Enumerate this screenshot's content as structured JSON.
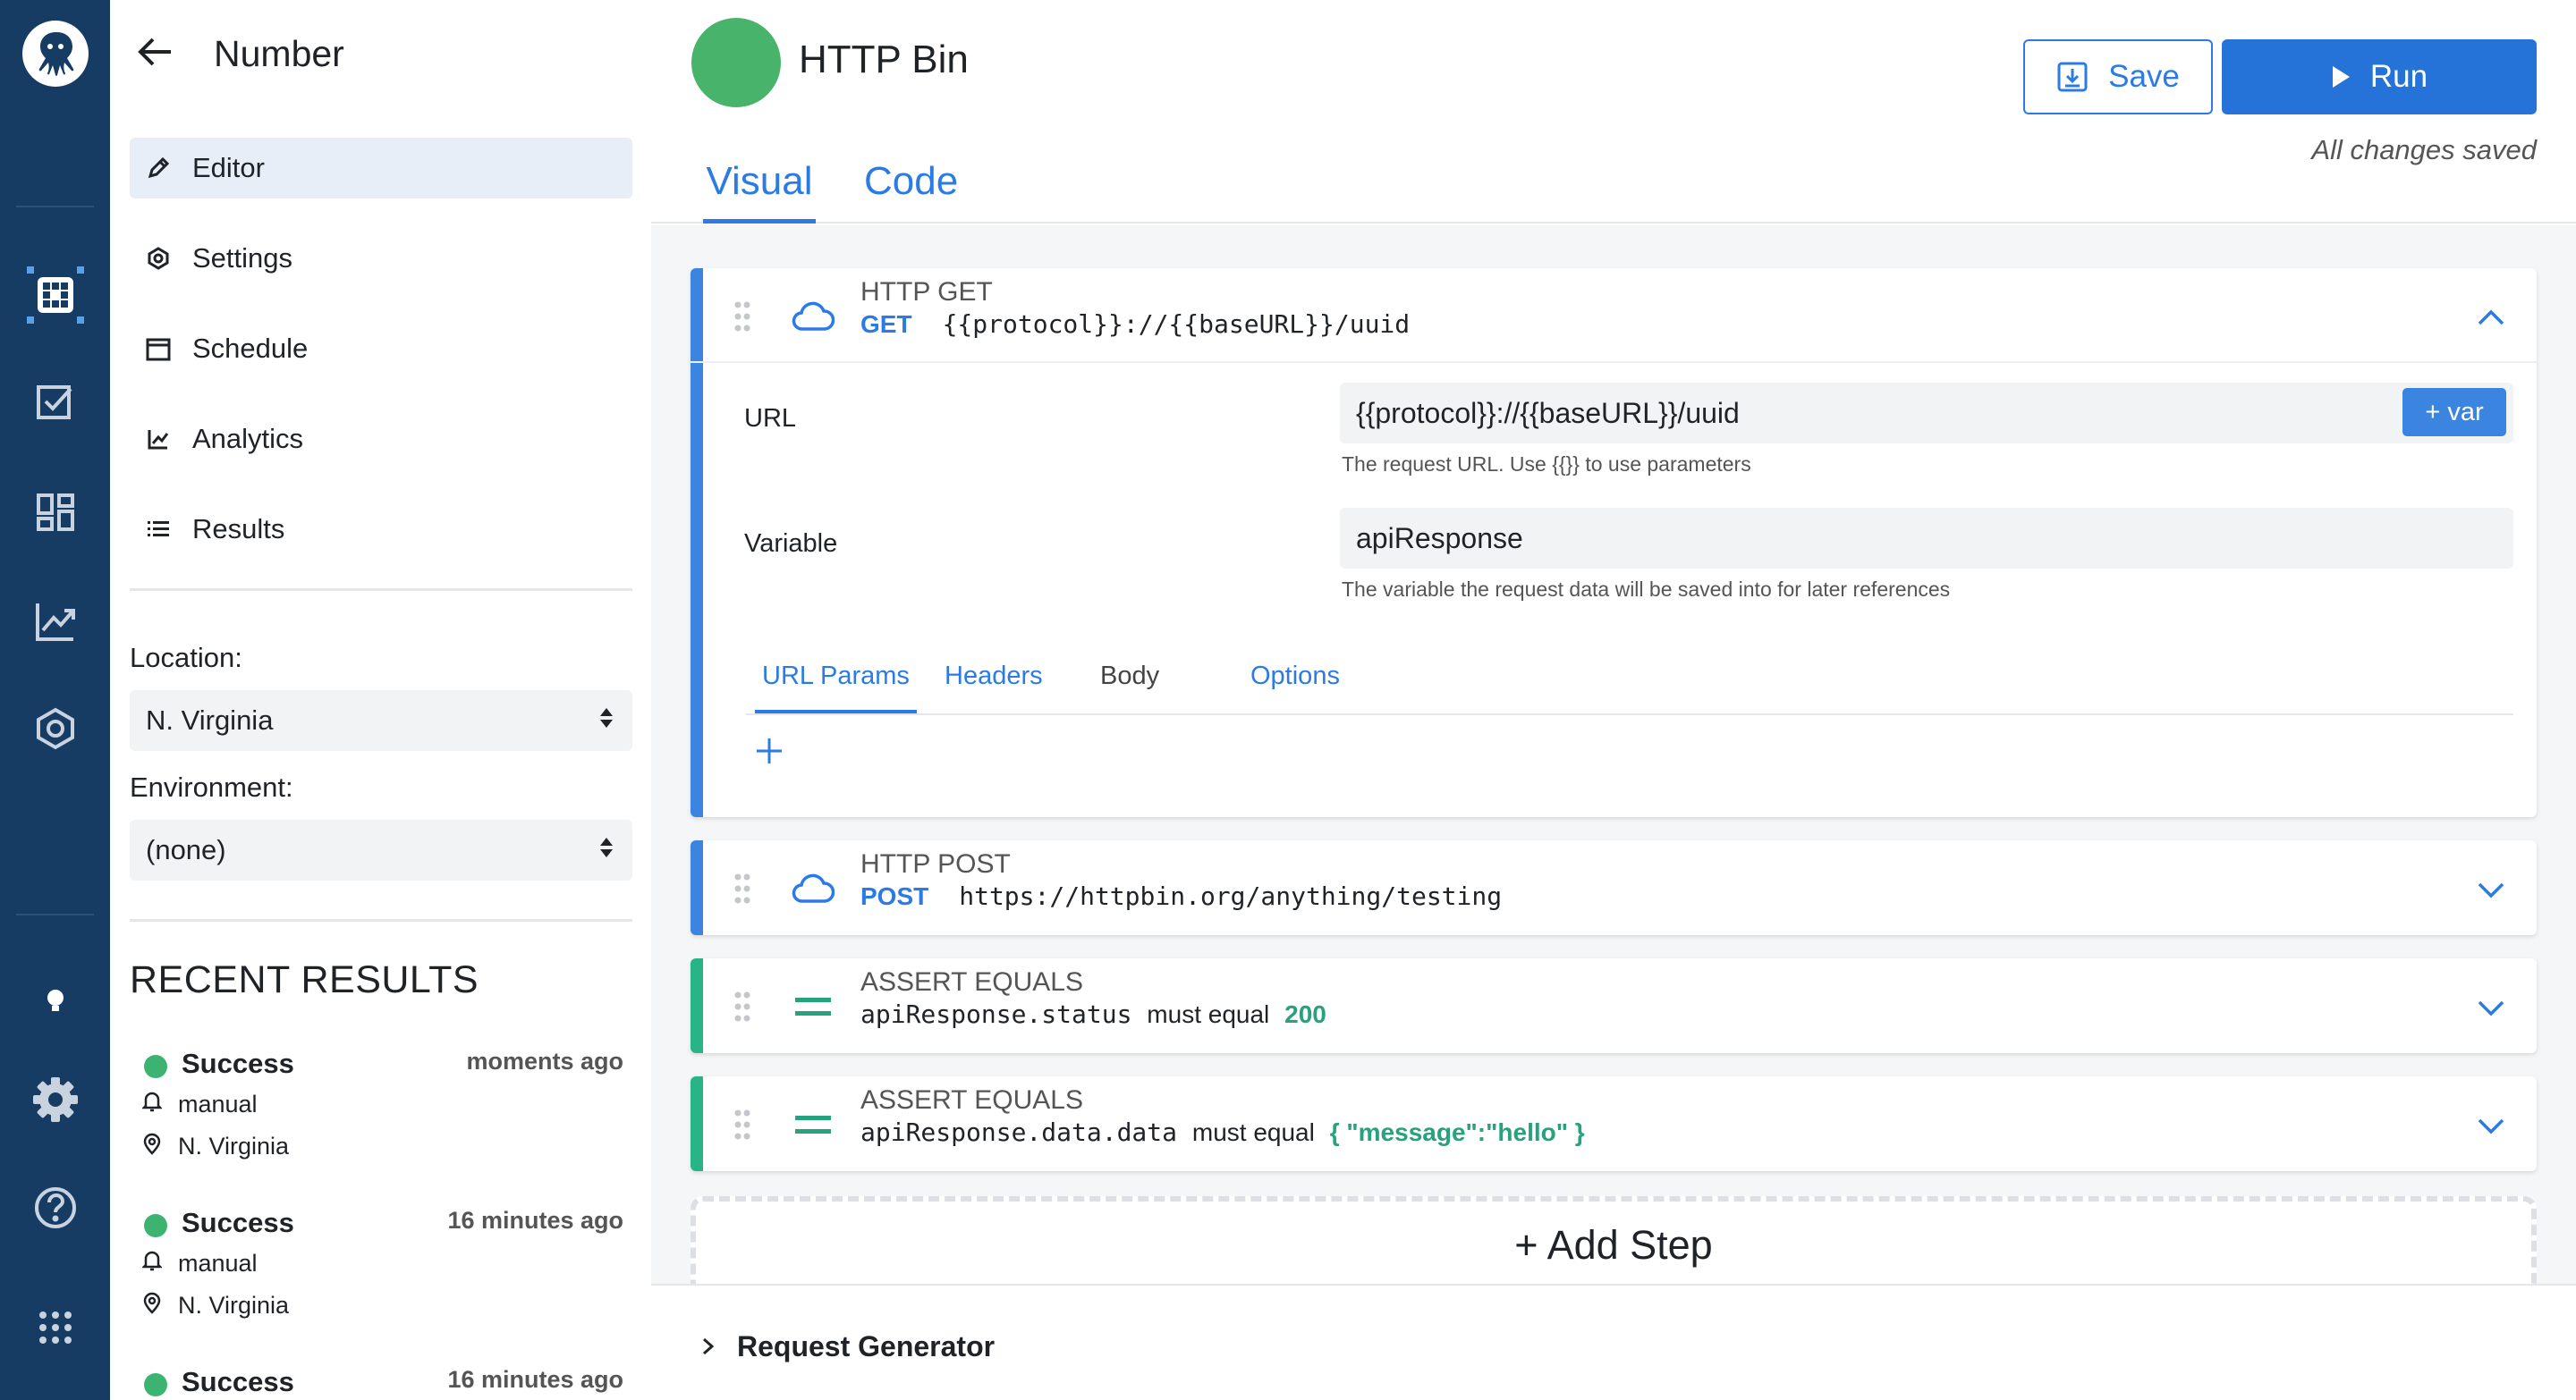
{
  "colors": {
    "rail_bg": "#163c63",
    "accent": "#2c7be5",
    "success": "#3cb371",
    "assert_stripe": "#28b487",
    "http_stripe": "#3b84e0"
  },
  "rail": {
    "items": [
      {
        "icon": "octopus-logo-icon"
      },
      {
        "icon": "grid-app-icon"
      },
      {
        "icon": "checklist-icon"
      },
      {
        "icon": "dashboard-icon"
      },
      {
        "icon": "analytics-icon"
      },
      {
        "icon": "monitor-icon"
      },
      {
        "icon": "lightbulb-icon"
      },
      {
        "icon": "gear-icon"
      },
      {
        "icon": "help-icon"
      },
      {
        "icon": "apps-grid-icon"
      }
    ]
  },
  "sidebar": {
    "title": "Number",
    "nav": [
      {
        "label": "Editor",
        "icon": "pencil-icon",
        "active": true
      },
      {
        "label": "Settings",
        "icon": "settings-icon",
        "active": false
      },
      {
        "label": "Schedule",
        "icon": "calendar-icon",
        "active": false
      },
      {
        "label": "Analytics",
        "icon": "chart-icon",
        "active": false
      },
      {
        "label": "Results",
        "icon": "list-icon",
        "active": false
      }
    ],
    "location_label": "Location:",
    "location_value": "N. Virginia",
    "environment_label": "Environment:",
    "environment_value": "(none)",
    "recent_title": "RECENT RESULTS",
    "results": [
      {
        "status": "Success",
        "time": "moments ago",
        "trigger": "manual",
        "location": "N. Virginia"
      },
      {
        "status": "Success",
        "time": "16 minutes ago",
        "trigger": "manual",
        "location": "N. Virginia"
      },
      {
        "status": "Success",
        "time": "16 minutes ago"
      }
    ]
  },
  "header": {
    "flow_name": "HTTP Bin",
    "save_label": "Save",
    "run_label": "Run",
    "saved_note": "All changes saved",
    "tabs": [
      {
        "label": "Visual",
        "active": true
      },
      {
        "label": "Code",
        "active": false
      }
    ]
  },
  "steps": [
    {
      "type": "HTTP GET",
      "method": "GET",
      "url": "{{protocol}}://{{baseURL}}/uuid",
      "expanded": true,
      "fields": {
        "url_label": "URL",
        "url_value": "{{protocol}}://{{baseURL}}/uuid",
        "var_button": "+ var",
        "url_hint": "The request URL. Use {{}} to use parameters",
        "variable_label": "Variable",
        "variable_value": "apiResponse",
        "variable_hint": "The variable the request data will be saved into for later references"
      },
      "subtabs": [
        {
          "label": "URL Params",
          "active": true
        },
        {
          "label": "Headers",
          "active": false
        },
        {
          "label": "Body",
          "active": false
        },
        {
          "label": "Options",
          "active": false
        }
      ]
    },
    {
      "type": "HTTP POST",
      "method": "POST",
      "url": "https://httpbin.org/anything/testing",
      "expanded": false
    },
    {
      "type": "ASSERT EQUALS",
      "left": "apiResponse.status",
      "keyword": "must equal",
      "right": "200",
      "expanded": false
    },
    {
      "type": "ASSERT EQUALS",
      "left": "apiResponse.data.data",
      "keyword": "must equal",
      "right": "{ \"message\":\"hello\" }",
      "expanded": false
    }
  ],
  "add_step_label": "+ Add Step",
  "bottom": {
    "request_generator_label": "Request Generator"
  }
}
